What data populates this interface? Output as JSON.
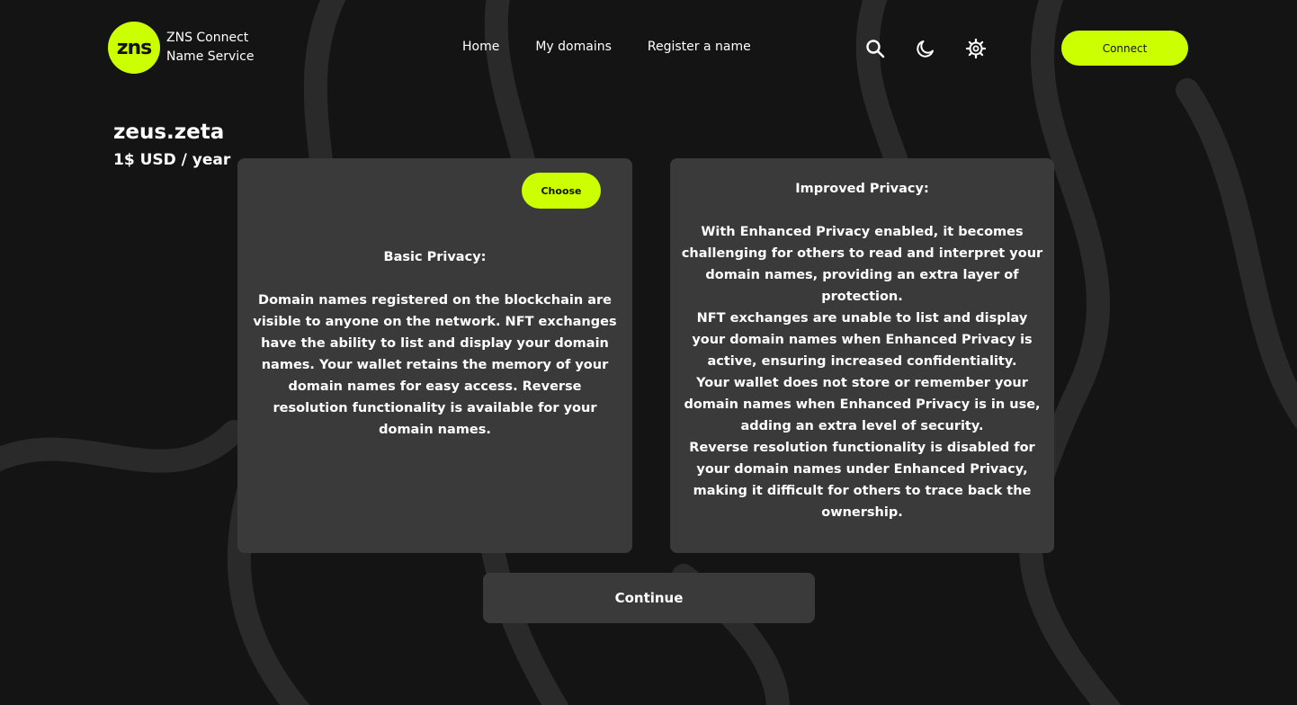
{
  "brand": {
    "logo_text": "zns",
    "name_line1": "ZNS Connect",
    "name_line2": "Name Service",
    "accent_color": "#ccff00"
  },
  "nav": {
    "home": "Home",
    "my_domains": "My domains",
    "register": "Register a name"
  },
  "header_icons": [
    "search-icon",
    "moon-icon",
    "gear-icon"
  ],
  "connect_label": "Connect",
  "domain": {
    "name": "zeus.zeta",
    "price": "1$ USD / year"
  },
  "basic": {
    "choose_label": "Choose",
    "heading": "Basic Privacy:",
    "body": "Domain names registered on the blockchain are visible to anyone on the network. NFT exchanges have the ability to list and display your domain names. Your wallet retains the memory of your domain names for easy access. Reverse resolution functionality is available for your domain names."
  },
  "improved": {
    "heading": "Improved Privacy:",
    "paragraphs": [
      "With Enhanced Privacy enabled, it becomes challenging for others to read and interpret your domain names, providing an extra layer of protection.",
      "NFT exchanges are unable to list and display your domain names when Enhanced Privacy is active, ensuring increased confidentiality.",
      "Your wallet does not store or remember your domain names when Enhanced Privacy is in use, adding an extra level of security.",
      "Reverse resolution functionality is disabled for your domain names under Enhanced Privacy, making it difficult for others to trace back the ownership."
    ]
  },
  "continue_label": "Continue"
}
